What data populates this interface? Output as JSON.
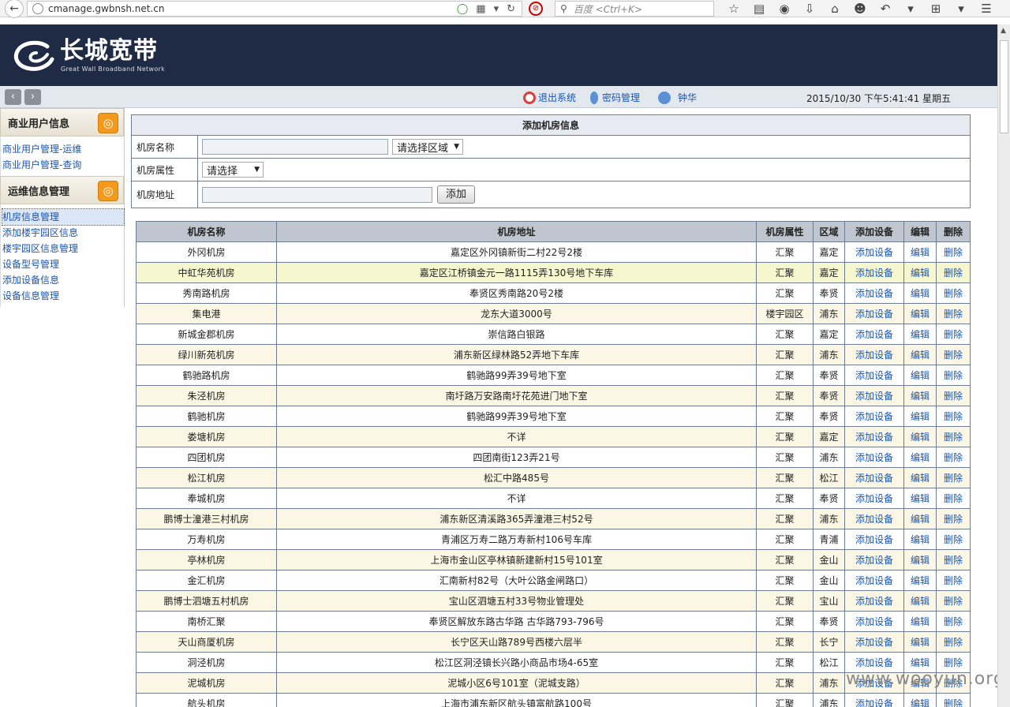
{
  "browser": {
    "url": "cmanage.gwbnsh.net.cn",
    "search_placeholder": "百度 <Ctrl+K>"
  },
  "brand": {
    "name_cn": "长城宽带",
    "name_en": "Great Wall Broadband Network"
  },
  "topbar": {
    "logout": "退出系统",
    "password": "密码管理",
    "user": "钟华",
    "datetime": "2015/10/30 下午5:41:41 星期五"
  },
  "sidebar": {
    "sections": [
      {
        "title": "商业用户信息",
        "items": [
          "商业用户管理-运维",
          "商业用户管理-查询"
        ]
      },
      {
        "title": "运维信息管理",
        "items": [
          "机房信息管理",
          "添加楼宇园区信息",
          "楼宇园区信息管理",
          "设备型号管理",
          "添加设备信息",
          "设备信息管理"
        ]
      }
    ]
  },
  "form": {
    "title": "添加机房信息",
    "name_label": "机房名称",
    "region_select": "请选择区域",
    "attr_label": "机房属性",
    "attr_select": "请选择",
    "addr_label": "机房地址",
    "add_button": "添加"
  },
  "table": {
    "headers": [
      "机房名称",
      "机房地址",
      "机房属性",
      "区域",
      "添加设备",
      "编辑",
      "删除"
    ],
    "rows": [
      [
        "外冈机房",
        "嘉定区外冈镇新街二村22号2楼",
        "汇聚",
        "嘉定"
      ],
      [
        "中虹华苑机房",
        "嘉定区江桥镇金元一路1115弄130号地下车库",
        "汇聚",
        "嘉定"
      ],
      [
        "秀南路机房",
        "奉贤区秀南路20号2楼",
        "汇聚",
        "奉贤"
      ],
      [
        "集电港",
        "龙东大道3000号",
        "楼宇园区",
        "浦东"
      ],
      [
        "新城金郡机房",
        "崇信路白银路",
        "汇聚",
        "嘉定"
      ],
      [
        "绿川新苑机房",
        "浦东新区绿林路52弄地下车库",
        "汇聚",
        "浦东"
      ],
      [
        "鹤驰路机房",
        "鹤驰路99弄39号地下室",
        "汇聚",
        "奉贤"
      ],
      [
        "朱泾机房",
        "南圩路万安路南圩花苑进门地下室",
        "汇聚",
        "奉贤"
      ],
      [
        "鹤驰机房",
        "鹤驰路99弄39号地下室",
        "汇聚",
        "奉贤"
      ],
      [
        "娄塘机房",
        "不详",
        "汇聚",
        "嘉定"
      ],
      [
        "四团机房",
        "四团南街123弄21号",
        "汇聚",
        "浦东"
      ],
      [
        "松江机房",
        "松汇中路485号",
        "汇聚",
        "松江"
      ],
      [
        "奉城机房",
        "不详",
        "汇聚",
        "奉贤"
      ],
      [
        "鹏博士潼港三村机房",
        "浦东新区清溪路365弄潼港三村52号",
        "汇聚",
        "浦东"
      ],
      [
        "万寿机房",
        "青浦区万寿二路万寿新村106号车库",
        "汇聚",
        "青浦"
      ],
      [
        "亭林机房",
        "上海市金山区亭林镇新建新村15号101室",
        "汇聚",
        "金山"
      ],
      [
        "金汇机房",
        "汇南新村82号（大叶公路金闸路口）",
        "汇聚",
        "金山"
      ],
      [
        "鹏博士泗塘五村机房",
        "宝山区泗塘五村33号物业管理处",
        "汇聚",
        "宝山"
      ],
      [
        "南桥汇聚",
        "奉贤区解放东路古华路 古华路793-796号",
        "汇聚",
        "奉贤"
      ],
      [
        "天山商厦机房",
        "长宁区天山路789号西楼六层半",
        "汇聚",
        "长宁"
      ],
      [
        "洞泾机房",
        "松江区洞泾镇长兴路小商品市场4-65室",
        "汇聚",
        "松江"
      ],
      [
        "泥城机房",
        "泥城小区6号101室（泥城支路）",
        "汇聚",
        "浦东"
      ],
      [
        "航头机房",
        "上海市浦东新区航头镇富航路100号",
        "汇聚",
        "浦东"
      ]
    ],
    "action_add": "添加设备",
    "action_edit": "编辑",
    "action_delete": "删除"
  },
  "watermark": "www.wooyun.org"
}
